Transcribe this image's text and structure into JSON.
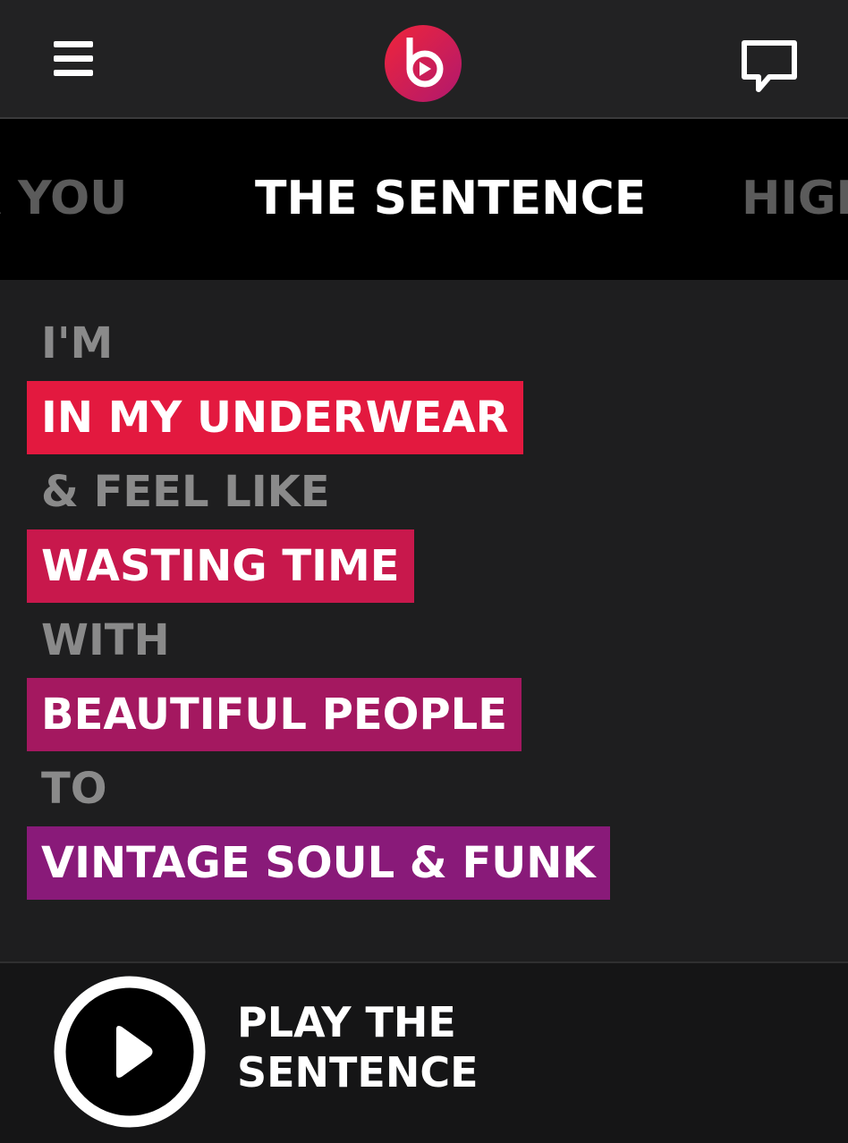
{
  "header": {
    "menu_icon": "hamburger-menu-icon",
    "logo_icon": "beats-logo-icon",
    "chat_icon": "speech-bubble-icon"
  },
  "tabs": {
    "left_partial": "R YOU",
    "active": "THE SENTENCE",
    "right_partial": "HIGH"
  },
  "sentence": [
    {
      "kind": "word",
      "text": "I'M"
    },
    {
      "kind": "choice",
      "text": "IN MY UNDERWEAR",
      "color": "#e3193f"
    },
    {
      "kind": "word",
      "text": "& FEEL LIKE"
    },
    {
      "kind": "choice",
      "text": "WASTING TIME",
      "color": "#c8184c"
    },
    {
      "kind": "word",
      "text": "WITH"
    },
    {
      "kind": "choice",
      "text": "BEAUTIFUL PEOPLE",
      "color": "#a41860"
    },
    {
      "kind": "word",
      "text": "TO"
    },
    {
      "kind": "choice",
      "text": "VINTAGE SOUL & FUNK",
      "color": "#891a79"
    }
  ],
  "player": {
    "play_icon": "play-icon",
    "label_line1": "PLAY THE",
    "label_line2": "SENTENCE"
  },
  "colors": {
    "background": "#1e1e1f",
    "tab_inactive": "#5b5b5b",
    "word_gray": "#8a8a8a",
    "brand_red": "#e3193f",
    "brand_purple": "#891a79"
  }
}
